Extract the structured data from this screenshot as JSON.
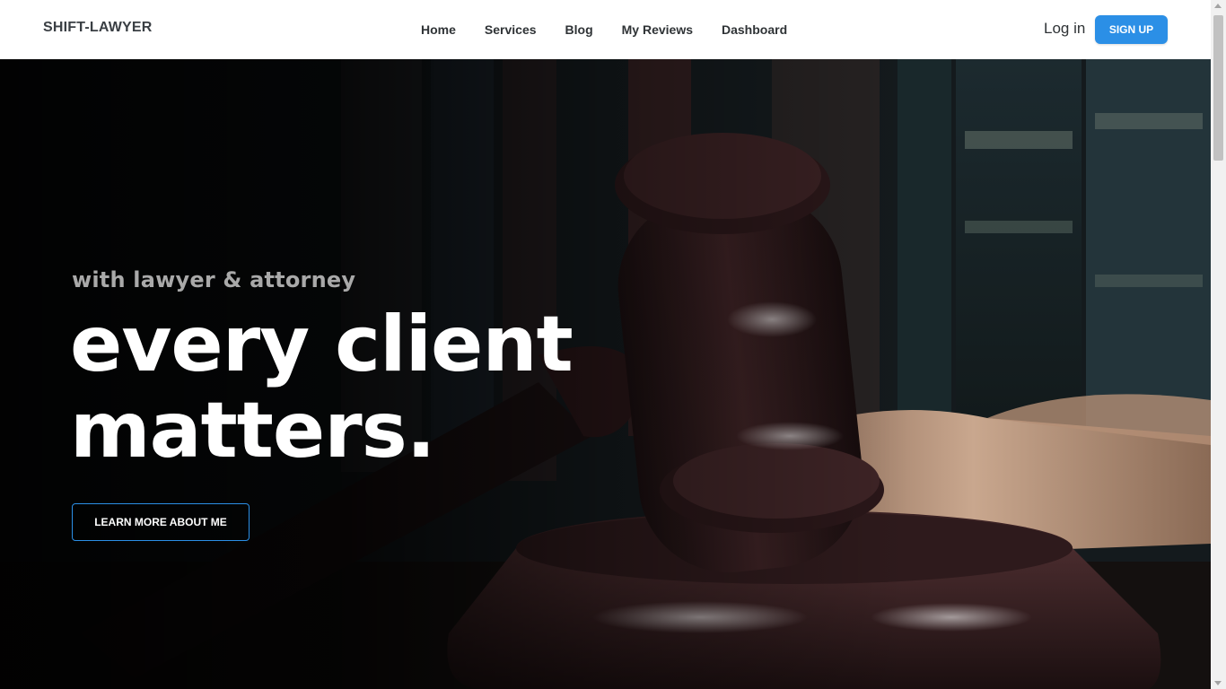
{
  "header": {
    "brand": "SHIFT-LAWYER",
    "nav": [
      {
        "label": "Home"
      },
      {
        "label": "Services"
      },
      {
        "label": "Blog"
      },
      {
        "label": "My Reviews"
      },
      {
        "label": "Dashboard"
      }
    ],
    "login_label": "Log in",
    "signup_label": "SIGN UP"
  },
  "hero": {
    "subtitle": "with lawyer & attorney",
    "title": "every client matters.",
    "cta_label": "LEARN MORE ABOUT ME",
    "image_icon": "gavel-on-books-image"
  },
  "colors": {
    "accent": "#2b8fe6",
    "brand_text": "#3a3f44",
    "hero_title": "#ffffff",
    "hero_subtitle": "#a9a9a9"
  }
}
